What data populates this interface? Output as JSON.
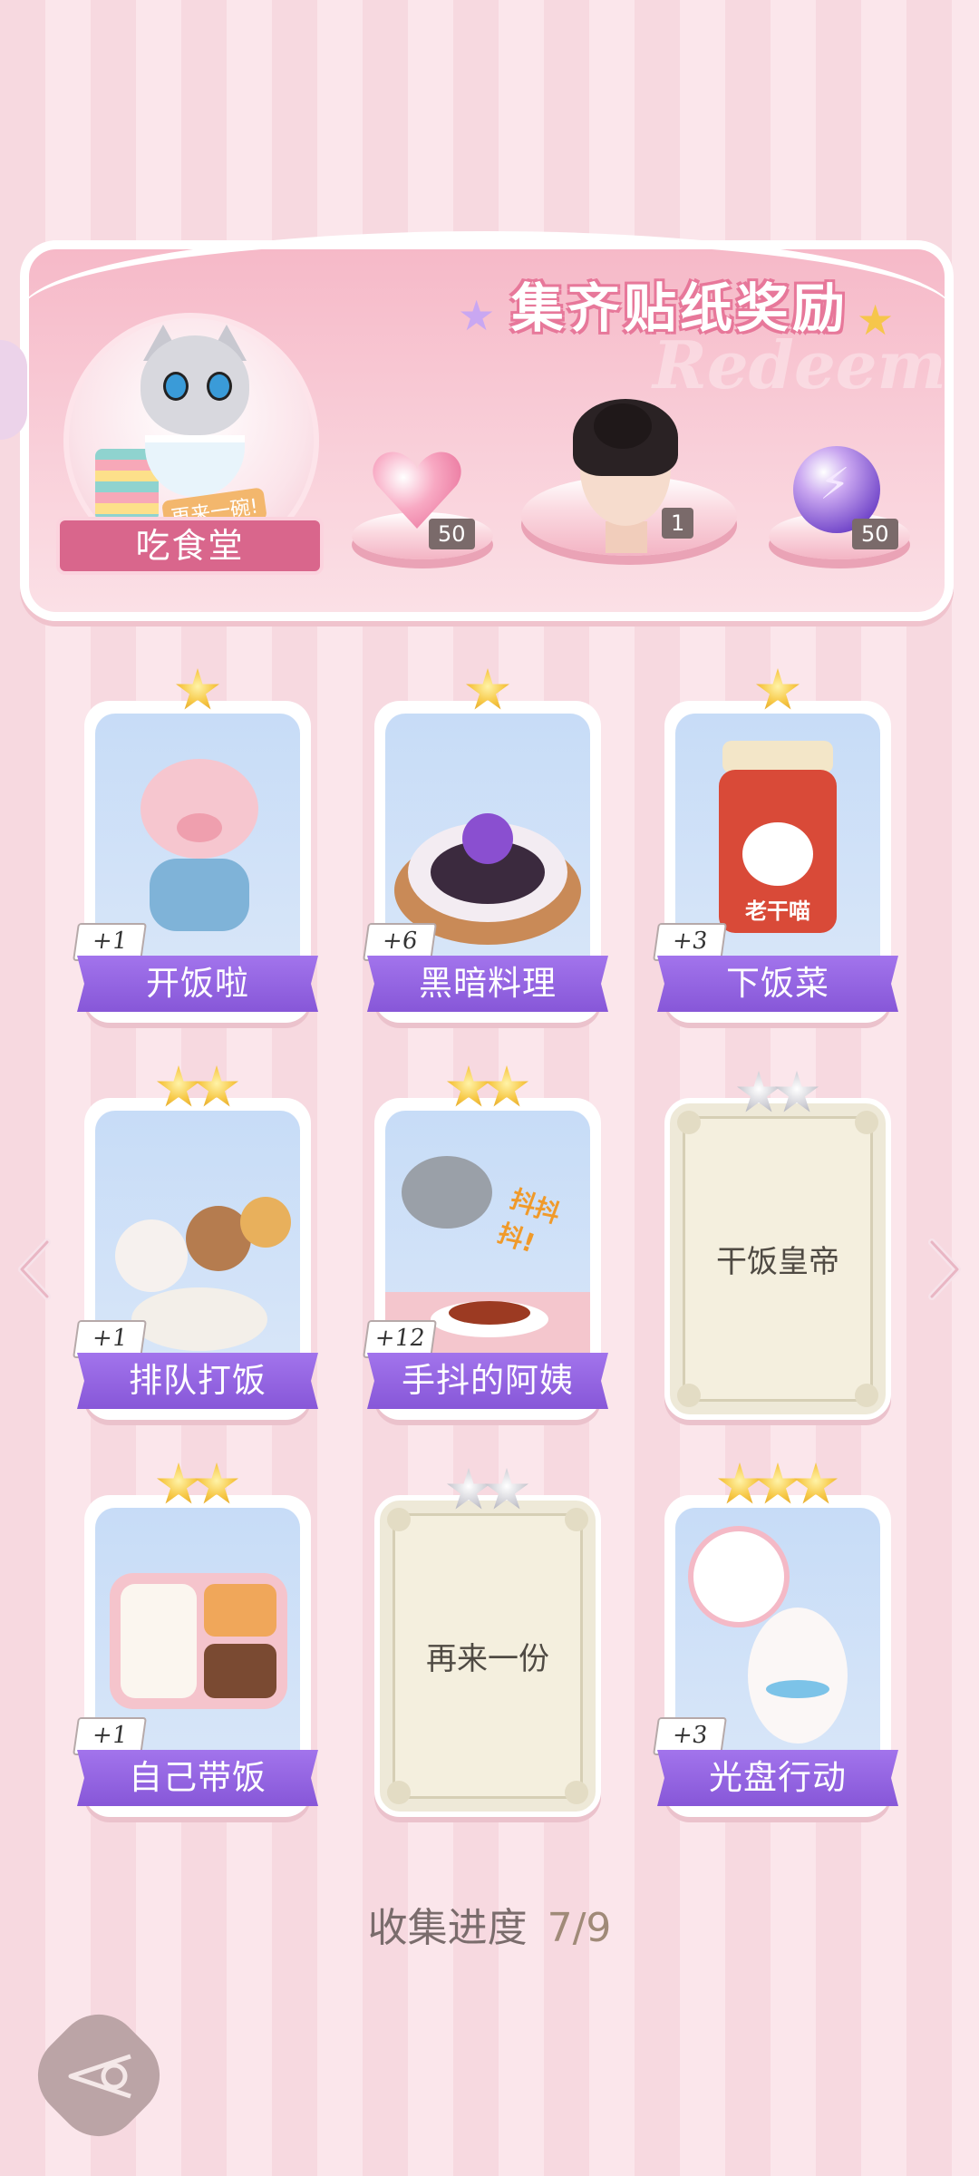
{
  "banner": {
    "title": "集齐贴纸奖励",
    "watermark": "Redeem",
    "avatar_tag": "再来一碗!",
    "category_label": "吃食堂",
    "rewards": [
      {
        "icon": "heart-gem-icon",
        "count": "50"
      },
      {
        "icon": "character-portrait",
        "count": "1"
      },
      {
        "icon": "energy-orb-icon",
        "count": "50"
      }
    ]
  },
  "cards": [
    {
      "name": "开饭啦",
      "stars": 1,
      "collected": true,
      "bonus": "+1"
    },
    {
      "name": "黑暗料理",
      "stars": 1,
      "collected": true,
      "bonus": "+6"
    },
    {
      "name": "下饭菜",
      "stars": 1,
      "collected": true,
      "bonus": "+3",
      "jar_label": "老干喵"
    },
    {
      "name": "排队打饭",
      "stars": 2,
      "collected": true,
      "bonus": "+1"
    },
    {
      "name": "手抖的阿姨",
      "stars": 2,
      "collected": true,
      "bonus": "+12",
      "art_text": "抖抖抖!"
    },
    {
      "name": "干饭皇帝",
      "stars": 2,
      "collected": false
    },
    {
      "name": "自己带饭",
      "stars": 2,
      "collected": true,
      "bonus": "+1"
    },
    {
      "name": "再来一份",
      "stars": 2,
      "collected": false
    },
    {
      "name": "光盘行动",
      "stars": 3,
      "collected": true,
      "bonus": "+3"
    }
  ],
  "progress": {
    "label": "收集进度",
    "value": "7/9",
    "collected": 7,
    "total": 9
  },
  "colors": {
    "ribbon": "#8f60e0",
    "banner_pink": "#f6b9c8",
    "star_gold": "#f7c948"
  }
}
